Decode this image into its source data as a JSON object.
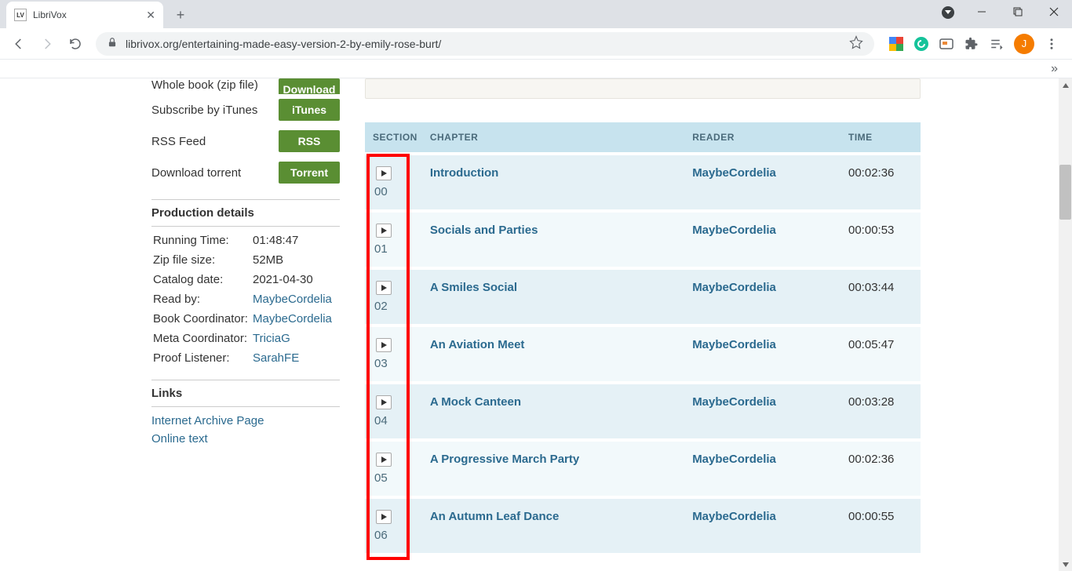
{
  "browser": {
    "tab_title": "LibriVox",
    "tab_favicon_text": "LV",
    "url": "librivox.org/entertaining-made-easy-version-2-by-emily-rose-burt/",
    "profile_letter": "J"
  },
  "sidebar": {
    "downloads": [
      {
        "label": "Whole book (zip file)",
        "btn": "Download"
      },
      {
        "label": "Subscribe by iTunes",
        "btn": "iTunes"
      },
      {
        "label": "RSS Feed",
        "btn": "RSS"
      },
      {
        "label": "Download torrent",
        "btn": "Torrent"
      }
    ],
    "prod_header": "Production details",
    "details": [
      {
        "k": "Running Time:",
        "v": "01:48:47",
        "link": false
      },
      {
        "k": "Zip file size:",
        "v": "52MB",
        "link": false
      },
      {
        "k": "Catalog date:",
        "v": "2021-04-30",
        "link": false
      },
      {
        "k": "Read by:",
        "v": "MaybeCordelia",
        "link": true
      },
      {
        "k": "Book Coordinator:",
        "v": "MaybeCordelia",
        "link": true
      },
      {
        "k": "Meta Coordinator:",
        "v": "TriciaG",
        "link": true
      },
      {
        "k": "Proof Listener:",
        "v": "SarahFE",
        "link": true
      }
    ],
    "links_header": "Links",
    "links": [
      "Internet Archive Page",
      "Online text"
    ]
  },
  "table": {
    "headers": {
      "section": "SECTION",
      "chapter": "CHAPTER",
      "reader": "READER",
      "time": "TIME"
    },
    "rows": [
      {
        "num": "00",
        "chapter": "Introduction",
        "reader": "MaybeCordelia",
        "time": "00:02:36"
      },
      {
        "num": "01",
        "chapter": "Socials and Parties",
        "reader": "MaybeCordelia",
        "time": "00:00:53"
      },
      {
        "num": "02",
        "chapter": "A Smiles Social",
        "reader": "MaybeCordelia",
        "time": "00:03:44"
      },
      {
        "num": "03",
        "chapter": "An Aviation Meet",
        "reader": "MaybeCordelia",
        "time": "00:05:47"
      },
      {
        "num": "04",
        "chapter": "A Mock Canteen",
        "reader": "MaybeCordelia",
        "time": "00:03:28"
      },
      {
        "num": "05",
        "chapter": "A Progressive March Party",
        "reader": "MaybeCordelia",
        "time": "00:02:36"
      },
      {
        "num": "06",
        "chapter": "An Autumn Leaf Dance",
        "reader": "MaybeCordelia",
        "time": "00:00:55"
      }
    ]
  }
}
